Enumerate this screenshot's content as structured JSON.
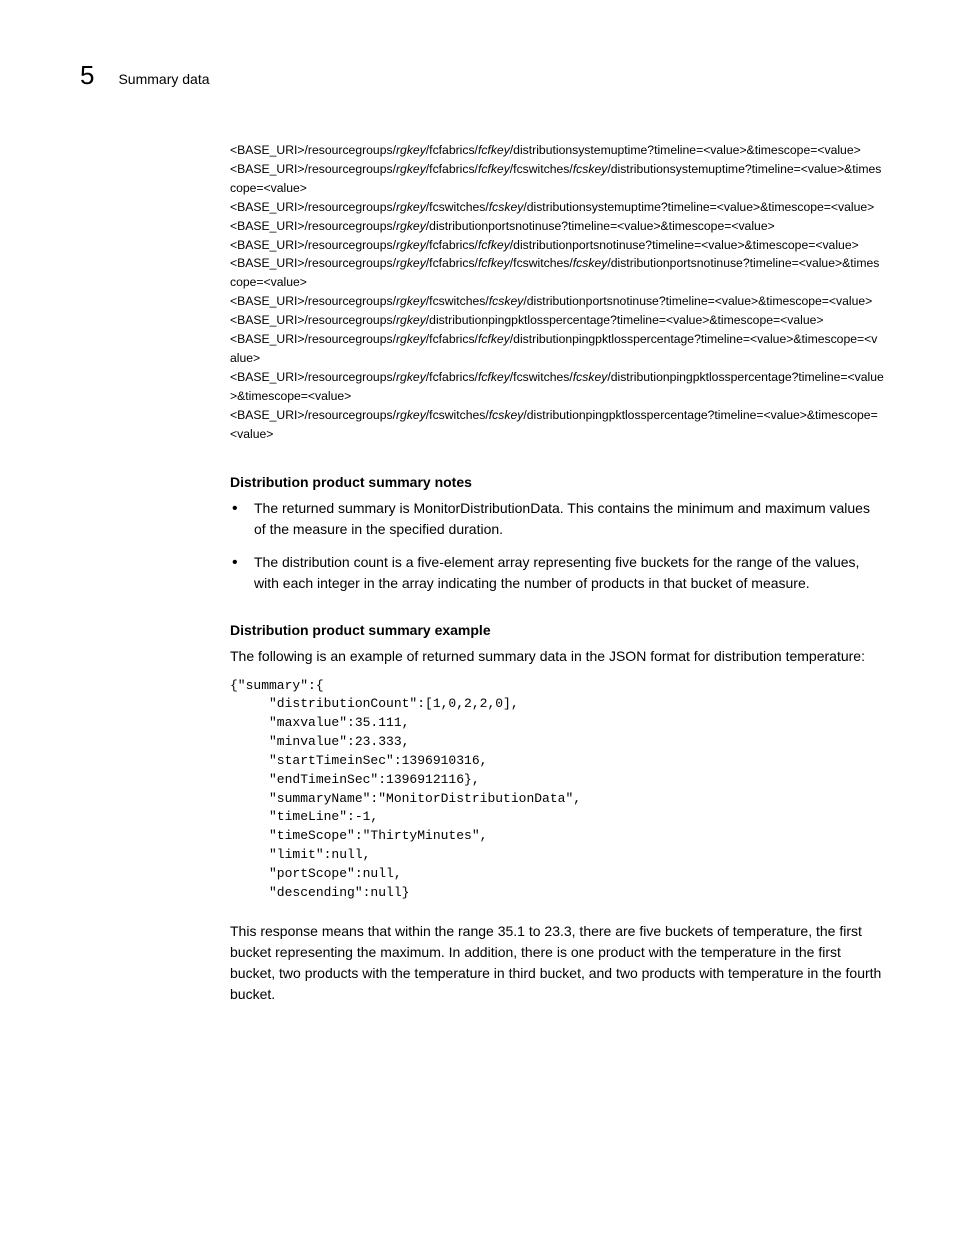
{
  "header": {
    "chapter_number": "5",
    "chapter_title": "Summary data"
  },
  "uris": [
    [
      {
        "t": "<BASE_URI>/resourcegroups/",
        "i": false
      },
      {
        "t": "rgkey",
        "i": true
      },
      {
        "t": "/fcfabrics/",
        "i": false
      },
      {
        "t": "fcfkey",
        "i": true
      },
      {
        "t": "/distributionsystemuptime?timeline=<value>&timescope=<value>",
        "i": false
      }
    ],
    [
      {
        "t": "<BASE_URI>/resourcegroups/",
        "i": false
      },
      {
        "t": "rgkey",
        "i": true
      },
      {
        "t": "/fcfabrics/",
        "i": false
      },
      {
        "t": "fcfkey",
        "i": true
      },
      {
        "t": "/fcswitches/",
        "i": false
      },
      {
        "t": "fcskey",
        "i": true
      },
      {
        "t": "/distributionsystemuptime?timeline=<value>&timescope=<value>",
        "i": false
      }
    ],
    [
      {
        "t": "<BASE_URI>/resourcegroups/",
        "i": false
      },
      {
        "t": "rgkey",
        "i": true
      },
      {
        "t": "/fcswitches/",
        "i": false
      },
      {
        "t": "fcskey",
        "i": true
      },
      {
        "t": "/distributionsystemuptime?timeline=<value>&timescope=<value>",
        "i": false
      }
    ],
    [
      {
        "t": "<BASE_URI>/resourcegroups/",
        "i": false
      },
      {
        "t": "rgkey",
        "i": true
      },
      {
        "t": "/distributionportsnotinuse?timeline=<value>&timescope=<value>",
        "i": false
      }
    ],
    [
      {
        "t": "<BASE_URI>/resourcegroups/",
        "i": false
      },
      {
        "t": "rgkey",
        "i": true
      },
      {
        "t": "/fcfabrics/",
        "i": false
      },
      {
        "t": "fcfkey",
        "i": true
      },
      {
        "t": "/distributionportsnotinuse?timeline=<value>&timescope=<value>",
        "i": false
      }
    ],
    [
      {
        "t": "<BASE_URI>/resourcegroups/",
        "i": false
      },
      {
        "t": "rgkey",
        "i": true
      },
      {
        "t": "/fcfabrics/",
        "i": false
      },
      {
        "t": "fcfkey",
        "i": true
      },
      {
        "t": "/fcswitches/",
        "i": false
      },
      {
        "t": "fcskey",
        "i": true
      },
      {
        "t": "/distributionportsnotinuse?timeline=<value>&timescope=<value>",
        "i": false
      }
    ],
    [
      {
        "t": "<BASE_URI>/resourcegroups/",
        "i": false
      },
      {
        "t": "rgkey",
        "i": true
      },
      {
        "t": "/fcswitches/",
        "i": false
      },
      {
        "t": "fcskey",
        "i": true
      },
      {
        "t": "/distributionportsnotinuse?timeline=<value>&timescope=<value>",
        "i": false
      }
    ],
    [
      {
        "t": "<BASE_URI>/resourcegroups/",
        "i": false
      },
      {
        "t": "rgkey",
        "i": true
      },
      {
        "t": "/distributionpingpktlosspercentage?timeline=<value>&timescope=<value>",
        "i": false
      }
    ],
    [
      {
        "t": "<BASE_URI>/resourcegroups/",
        "i": false
      },
      {
        "t": "rgkey",
        "i": true
      },
      {
        "t": "/fcfabrics/",
        "i": false
      },
      {
        "t": "fcfkey",
        "i": true
      },
      {
        "t": "/distributionpingpktlosspercentage?timeline=<value>&timescope=<value>",
        "i": false
      }
    ],
    [
      {
        "t": "<BASE_URI>/resourcegroups/",
        "i": false
      },
      {
        "t": "rgkey",
        "i": true
      },
      {
        "t": "/fcfabrics/",
        "i": false
      },
      {
        "t": "fcfkey",
        "i": true
      },
      {
        "t": "/fcswitches/",
        "i": false
      },
      {
        "t": "fcskey",
        "i": true
      },
      {
        "t": "/distributionpingpktlosspercentage?timeline=<value>&timescope=<value>",
        "i": false
      }
    ],
    [
      {
        "t": "<BASE_URI>/resourcegroups/",
        "i": false
      },
      {
        "t": "rgkey",
        "i": true
      },
      {
        "t": "/fcswitches/",
        "i": false
      },
      {
        "t": "fcskey",
        "i": true
      },
      {
        "t": "/distributionpingpktlosspercentage?timeline=<value>&timescope=<value>",
        "i": false
      }
    ]
  ],
  "notes": {
    "heading": "Distribution product summary notes",
    "bullets": [
      "The returned summary is MonitorDistributionData. This contains the minimum and maximum values of the measure in the specified duration.",
      "The distribution count is a five-element array representing five buckets for the range of the values, with each integer in the array indicating the number of products in that bucket of measure."
    ]
  },
  "example": {
    "heading": "Distribution product summary example",
    "intro": "The following is an example of returned summary data in the JSON format for distribution temperature:",
    "code": "{\"summary\":{\n     \"distributionCount\":[1,0,2,2,0],\n     \"maxvalue\":35.111,\n     \"minvalue\":23.333,\n     \"startTimeinSec\":1396910316,\n     \"endTimeinSec\":1396912116},\n     \"summaryName\":\"MonitorDistributionData\",\n     \"timeLine\":-1,\n     \"timeScope\":\"ThirtyMinutes\",\n     \"limit\":null,\n     \"portScope\":null,\n     \"descending\":null}",
    "explanation": "This response means that within the range 35.1 to 23.3, there are five buckets of temperature, the first bucket representing the maximum. In addition, there is one product with the temperature in the first bucket, two products with the temperature in third bucket, and two products with temperature in the fourth bucket."
  }
}
